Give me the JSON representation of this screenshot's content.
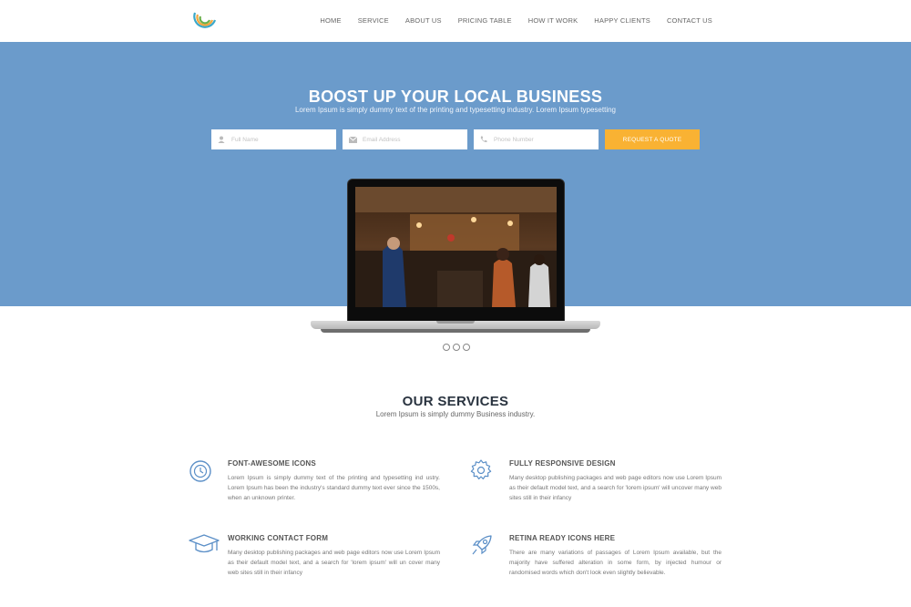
{
  "nav": {
    "items": [
      "HOME",
      "SERVICE",
      "ABOUT US",
      "PRICING TABLE",
      "HOW IT WORK",
      "HAPPY CLIENTS",
      "CONTACT US"
    ]
  },
  "hero": {
    "title": "BOOST UP YOUR LOCAL BUSINESS",
    "subtitle": "Lorem Ipsum is simply dummy text of the printing and typesetting industry. Lorem Ipsum typesetting",
    "form": {
      "name_placeholder": "Full Name",
      "email_placeholder": "Email Address",
      "phone_placeholder": "Phone Number",
      "button_label": "REQUEST A QUOTE"
    }
  },
  "slider": {
    "dot_count": 3
  },
  "services": {
    "title": "OUR SERVICES",
    "subtitle": "Lorem Ipsum is simply dummy Business industry.",
    "items": [
      {
        "title": "FONT-AWESOME ICONS",
        "text": "Lorem Ipsum is simply dummy text of the printing and typesetting ind ustry. Lorem Ipsum has been the industry's standard dummy text ever since the 1500s, when an unknown printer.",
        "icon": "clock-icon"
      },
      {
        "title": "FULLY RESPONSIVE DESIGN",
        "text": "Many desktop publishing packages and web page editors now use Lorem Ipsum as their default model text, and a search for 'lorem ipsum' will uncover many web sites still in their infancy",
        "icon": "gear-icon"
      },
      {
        "title": "WORKING CONTACT FORM",
        "text": "Many desktop publishing packages and web page editors now use Lorem Ipsum as their default model text, and a search for 'lorem ipsum' will un cover many web sites still in their infancy",
        "icon": "graduation-cap-icon"
      },
      {
        "title": "RETINA READY ICONS HERE",
        "text": "There are many variations of passages of Lorem Ipsum available, but the majority have suffered alteration in some form, by injected humour or randomised words which don't look even slightly believable.",
        "icon": "rocket-icon"
      }
    ]
  },
  "colors": {
    "hero_bg": "#6b9bcb",
    "button": "#f9b233",
    "icon_blue": "#5b8fc7",
    "heading_dark": "#2a3440"
  }
}
